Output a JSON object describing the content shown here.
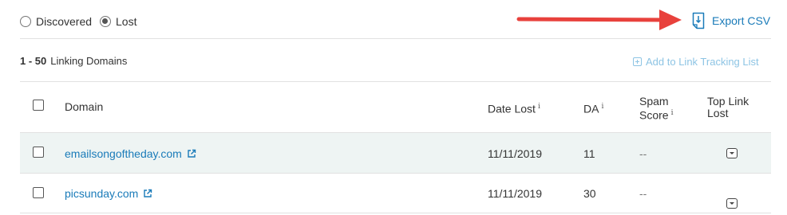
{
  "filter": {
    "options": [
      {
        "label": "Discovered",
        "checked": false
      },
      {
        "label": "Lost",
        "checked": true
      }
    ]
  },
  "export": {
    "label": "Export CSV"
  },
  "summary": {
    "range": "1 - 50",
    "label": "Linking Domains"
  },
  "add_to_list": {
    "label": "Add to Link Tracking List"
  },
  "table": {
    "headers": {
      "domain": "Domain",
      "date_lost": "Date Lost",
      "da": "DA",
      "spam_line1": "Spam",
      "spam_line2": "Score",
      "top_link_line1": "Top Link",
      "top_link_line2": "Lost",
      "info_glyph": "i"
    },
    "rows": [
      {
        "domain": "emailsongoftheday.com",
        "date_lost": "11/11/2019",
        "da": "11",
        "spam": "--"
      },
      {
        "domain": "picsunday.com",
        "date_lost": "11/11/2019",
        "da": "30",
        "spam": "--"
      }
    ]
  },
  "colors": {
    "link": "#1a7bb9",
    "row_highlight": "#eef4f3",
    "arrow": "#e8413c"
  }
}
